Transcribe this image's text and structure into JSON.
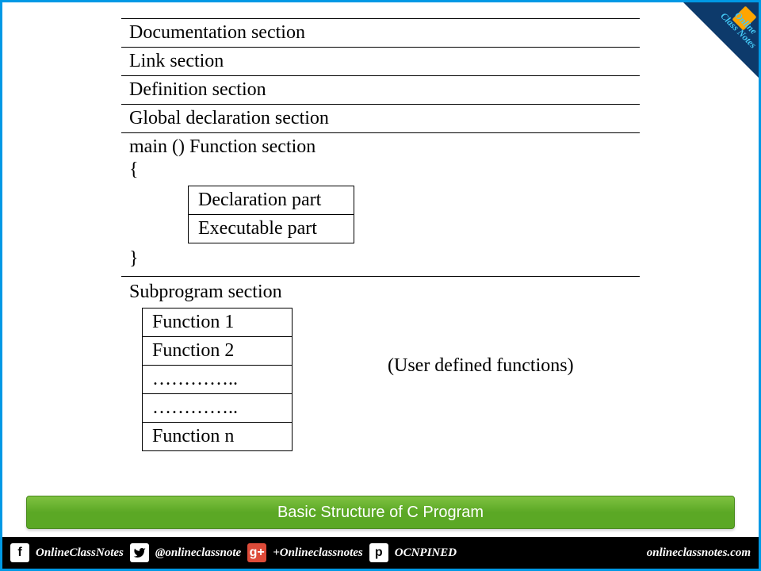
{
  "sections": {
    "s1": "Documentation section",
    "s2": "Link section",
    "s3": "Definition section",
    "s4": "Global declaration section"
  },
  "main": {
    "title": "main () Function section",
    "open": "{",
    "close": "}",
    "part1": "Declaration part",
    "part2": "Executable part"
  },
  "sub": {
    "title": "Subprogram section",
    "f1": "Function 1",
    "f2": "Function 2",
    "dots1": "…………..",
    "dots2": "…………..",
    "fn": "Function n",
    "note": "(User defined functions)"
  },
  "caption": "Basic Structure of C Program",
  "footer": {
    "fb": "OnlineClassNotes",
    "tw": "@onlineclassnote",
    "gp": "+Onlineclassnotes",
    "pin": "OCNPINED",
    "site": "onlineclassnotes.com"
  },
  "ribbon": {
    "line1": "Online",
    "line2": "Class Notes"
  }
}
